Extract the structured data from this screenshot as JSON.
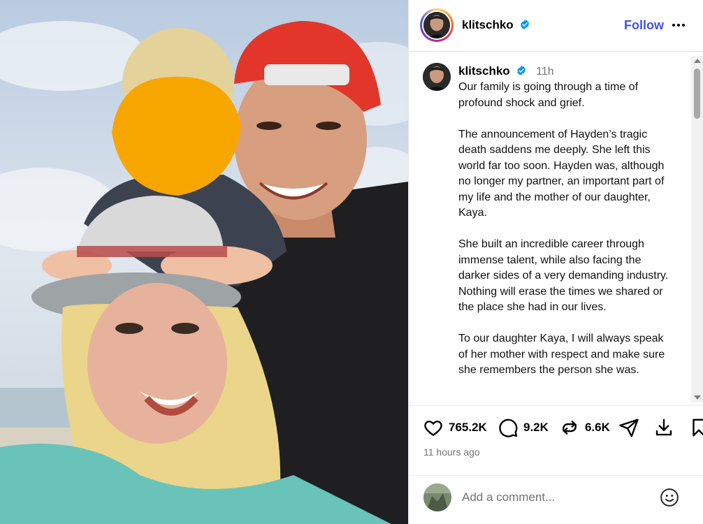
{
  "post": {
    "username": "klitschko",
    "verified": true,
    "follow_label": "Follow",
    "posted_ago_short": "11h",
    "caption_paragraphs": [
      "Our family is going through a time of profound shock and grief.",
      "The announcement of Hayden’s tragic death saddens me deeply. She left this world far too soon. Hayden was, although no longer my partner, an important part of my life and the mother of our daughter, Kaya.",
      "She built an incredible career through immense talent, while also facing the darker sides of a very demanding industry. Nothing will erase the times we shared or the place she had in our lives.",
      "To our daughter Kaya, I will always speak of her mother with respect and make sure she remembers the person she was."
    ],
    "likes": "765.2K",
    "comments": "9.2K",
    "reposts": "6.6K",
    "posted_ago_long": "11 hours ago"
  },
  "comment_box": {
    "placeholder": "Add a comment..."
  },
  "icons": {
    "like": "heart-icon",
    "comment": "comment-bubble-icon",
    "repost": "repost-icon",
    "share": "share-paper-plane-icon",
    "download": "download-icon",
    "save": "bookmark-icon",
    "more": "more-options-icon",
    "emoji": "emoji-icon",
    "verified": "verified-badge-icon"
  },
  "colors": {
    "follow": "#4150f7",
    "verified_badge": "#0095f6",
    "muted_text": "#737373",
    "story_ring": "#d62976",
    "face_blur": "#f7a600"
  }
}
